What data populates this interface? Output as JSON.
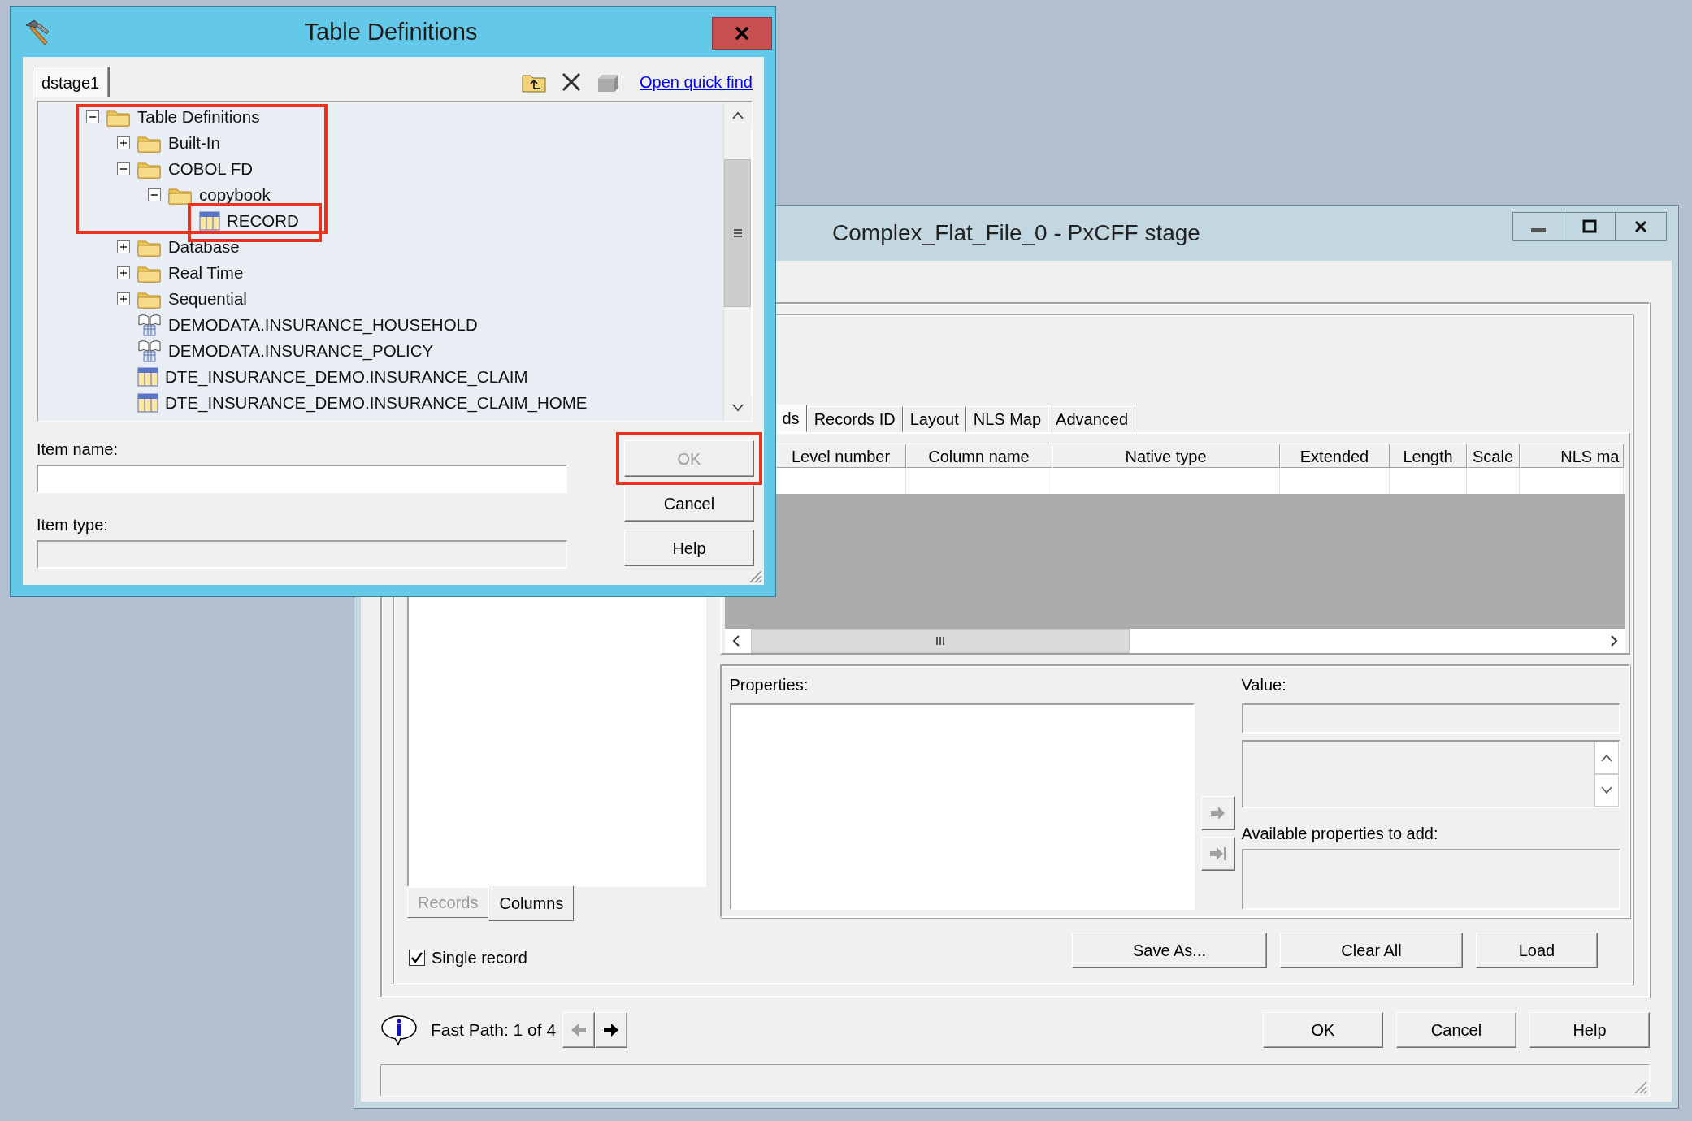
{
  "table_definitions_dialog": {
    "title": "Table Definitions",
    "tabs": [
      {
        "label": "dstage1",
        "selected": true
      }
    ],
    "quick_find_link": "Open quick find",
    "tree": [
      {
        "label": "Table Definitions",
        "kind": "folder",
        "expanded": true,
        "highlighted": true,
        "children": [
          {
            "label": "Built-In",
            "kind": "folder",
            "expanded": false,
            "highlighted": true
          },
          {
            "label": "COBOL FD",
            "kind": "folder",
            "expanded": true,
            "highlighted": true,
            "children": [
              {
                "label": "copybook",
                "kind": "folder",
                "expanded": true,
                "highlighted": true,
                "children": [
                  {
                    "label": "RECORD",
                    "kind": "table",
                    "highlighted": true
                  }
                ]
              }
            ]
          },
          {
            "label": "Database",
            "kind": "folder",
            "expanded": false,
            "highlighted": false
          },
          {
            "label": "Real Time",
            "kind": "folder",
            "expanded": false,
            "highlighted": false
          },
          {
            "label": "Sequential",
            "kind": "folder",
            "expanded": false,
            "highlighted": false
          },
          {
            "label": "DEMODATA.INSURANCE_HOUSEHOLD",
            "kind": "book",
            "highlighted": false
          },
          {
            "label": "DEMODATA.INSURANCE_POLICY",
            "kind": "book",
            "highlighted": false
          },
          {
            "label": "DTE_INSURANCE_DEMO.INSURANCE_CLAIM",
            "kind": "table",
            "highlighted": false
          },
          {
            "label": "DTE_INSURANCE_DEMO.INSURANCE_CLAIM_HOME",
            "kind": "table",
            "highlighted": false
          }
        ]
      }
    ],
    "item_name": {
      "label": "Item name:"
    },
    "item_type": {
      "label": "Item type:",
      "disabled": true
    },
    "buttons": [
      {
        "label": "OK",
        "disabled": true,
        "highlighted": true
      },
      {
        "label": "Cancel",
        "disabled": false,
        "highlighted": false
      },
      {
        "label": "Help",
        "disabled": false,
        "highlighted": false
      }
    ]
  },
  "stage_window": {
    "title": "Complex_Flat_File_0 - PxCFF stage",
    "tabs": [
      {
        "label": "ds",
        "selected": true
      },
      {
        "label": "Records ID",
        "selected": false
      },
      {
        "label": "Layout",
        "selected": false
      },
      {
        "label": "NLS Map",
        "selected": false
      },
      {
        "label": "Advanced",
        "selected": false
      }
    ],
    "columns": [
      "Level number",
      "Column name",
      "Native type",
      "Extended",
      "Length",
      "Scale",
      "NLS ma"
    ],
    "properties_label": "Properties:",
    "value_label": "Value:",
    "available_label": "Available properties to add:",
    "move_buttons": [
      {
        "kind": "add",
        "disabled": true
      },
      {
        "kind": "add_all",
        "disabled": true
      }
    ],
    "grid_buttons": [
      "Save As...",
      "Clear All",
      "Load"
    ],
    "list_tabs": [
      {
        "label": "Records",
        "selected": false,
        "disabled": true
      },
      {
        "label": "Columns",
        "selected": true,
        "disabled": false
      }
    ],
    "single_record": {
      "label": "Single record",
      "checked": true
    },
    "fast_path": {
      "text": "Fast Path: 1 of 4",
      "prev_disabled": true,
      "next_disabled": false
    },
    "buttons": [
      "OK",
      "Cancel",
      "Help"
    ]
  }
}
